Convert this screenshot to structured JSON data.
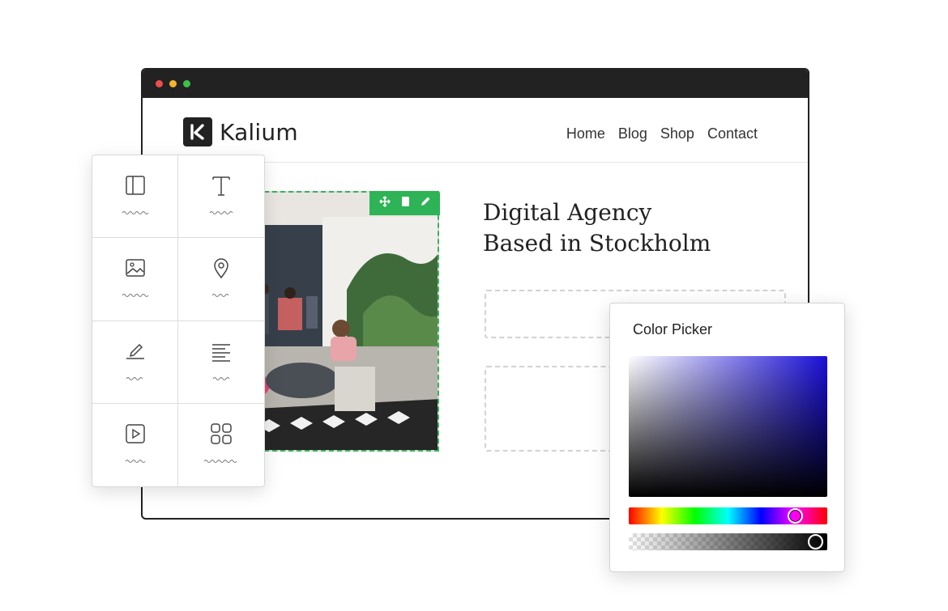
{
  "site": {
    "logo_text": "Kalium",
    "nav": [
      "Home",
      "Blog",
      "Shop",
      "Contact"
    ],
    "headline_line1": "Digital Agency",
    "headline_line2": "Based in Stockholm"
  },
  "palette": {
    "tiles": [
      "columns-layout-icon",
      "text-icon",
      "image-icon",
      "map-pin-icon",
      "pen-icon",
      "paragraph-align-icon",
      "video-play-icon",
      "grid-icon"
    ]
  },
  "image_toolbar": [
    "move-icon",
    "copy-icon",
    "edit-pencil-icon"
  ],
  "color_picker": {
    "title": "Color Picker",
    "hue_position_fraction": 0.84,
    "alpha_position_fraction": 0.94,
    "base_color": "#1a0fd8"
  },
  "colors": {
    "editor_accent": "#2eb356",
    "window_chrome": "#222222"
  }
}
